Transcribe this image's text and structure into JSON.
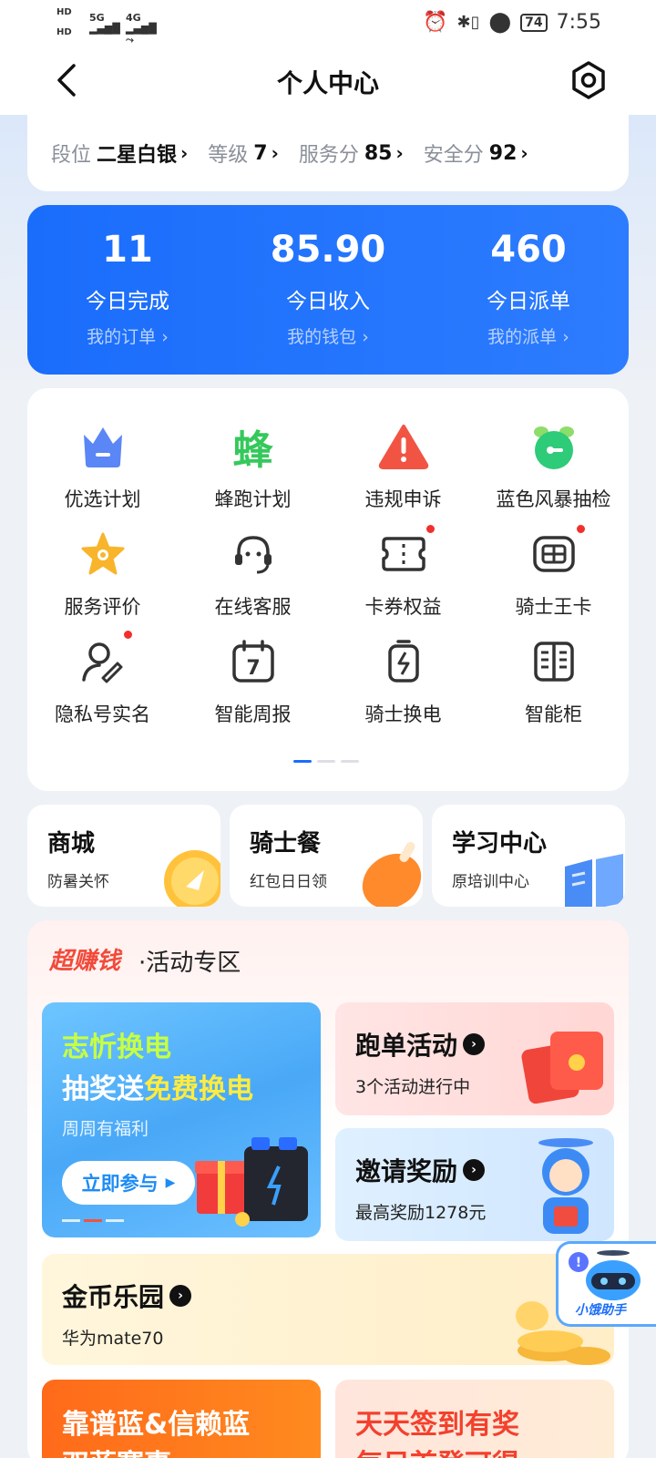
{
  "status_bar": {
    "left_top": "HD",
    "left_bottom": "HD",
    "net1": "5G",
    "net2": "4G",
    "battery": "74",
    "time": "7:55"
  },
  "header": {
    "title": "个人中心"
  },
  "rank": [
    {
      "label": "段位",
      "value": "二星白银"
    },
    {
      "label": "等级",
      "value": "7"
    },
    {
      "label": "服务分",
      "value": "85"
    },
    {
      "label": "安全分",
      "value": "92"
    }
  ],
  "stats": [
    {
      "value": "11",
      "label": "今日完成",
      "link": "我的订单 ›"
    },
    {
      "value": "85.90",
      "label": "今日收入",
      "link": "我的钱包 ›"
    },
    {
      "value": "460",
      "label": "今日派单",
      "link": "我的派单 ›"
    }
  ],
  "services": [
    {
      "label": "优选计划",
      "icon": "crown-icon"
    },
    {
      "label": "蜂跑计划",
      "icon": "bee-icon",
      "glyph": "蜂"
    },
    {
      "label": "违规申诉",
      "icon": "warning-icon"
    },
    {
      "label": "蓝色风暴抽检",
      "icon": "alarm-clock-icon"
    },
    {
      "label": "服务评价",
      "icon": "star-icon"
    },
    {
      "label": "在线客服",
      "icon": "headset-icon"
    },
    {
      "label": "卡券权益",
      "icon": "coupon-icon"
    },
    {
      "label": "骑士王卡",
      "icon": "sim-card-icon"
    },
    {
      "label": "隐私号实名",
      "icon": "user-verify-icon"
    },
    {
      "label": "智能周报",
      "icon": "calendar-icon",
      "glyph": "7"
    },
    {
      "label": "骑士换电",
      "icon": "battery-swap-icon"
    },
    {
      "label": "智能柜",
      "icon": "locker-icon"
    }
  ],
  "shortcuts": [
    {
      "title": "商城",
      "sub": "防暑关怀"
    },
    {
      "title": "骑士餐",
      "sub": "红包日日领"
    },
    {
      "title": "学习中心",
      "sub": "原培训中心"
    }
  ],
  "activity": {
    "hot": "超赚钱",
    "title": "·活动专区",
    "promo": {
      "line1": "志忻换电",
      "line2a": "抽奖送",
      "line2b": "免费换电",
      "line3": "周周有福利",
      "button": "立即参与"
    },
    "run": {
      "title": "跑单活动",
      "sub": "3个活动进行中"
    },
    "invite": {
      "title": "邀请奖励",
      "sub": "最高奖励1278元"
    },
    "coin": {
      "title": "金币乐园",
      "sub": "华为mate70"
    },
    "banner1": {
      "line1": "靠谱蓝&信赖蓝",
      "line2": "双蓝赛事"
    },
    "banner2": {
      "line1": "天天签到有奖",
      "line2": "每日首登可得"
    }
  },
  "assistant": {
    "label": "小饿助手"
  },
  "colors": {
    "primary_blue": "#1a6dfb",
    "red_dot": "#f1302e",
    "hot_red": "#f24a3a"
  }
}
